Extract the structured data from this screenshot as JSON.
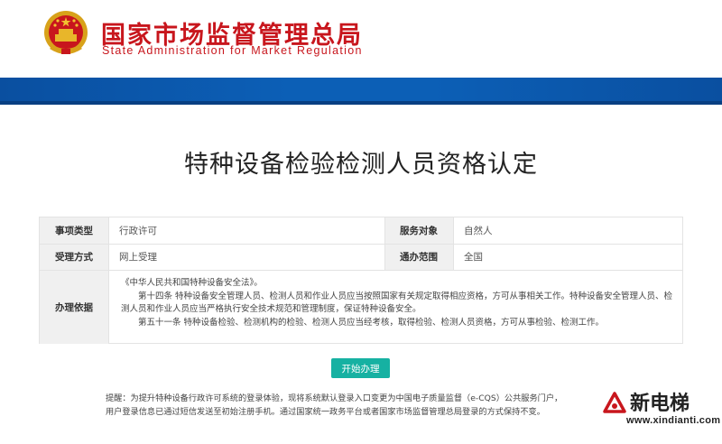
{
  "header": {
    "org_name_cn": "国家市场监督管理总局",
    "org_name_en": "State Administration for Market Regulation",
    "emblem_icon": "national-emblem-icon",
    "brand_color": "#c8161d",
    "bar_color": "#0c5fb6"
  },
  "page": {
    "title": "特种设备检验检测人员资格认定"
  },
  "info": {
    "type_label": "事项类型",
    "type_value": "行政许可",
    "target_label": "服务对象",
    "target_value": "自然人",
    "method_label": "受理方式",
    "method_value": "网上受理",
    "scope_label": "通办范围",
    "scope_value": "全国",
    "basis_label": "办理依据",
    "basis_lines": [
      "《中华人民共和国特种设备安全法》。",
      "第十四条 特种设备安全管理人员、检测人员和作业人员应当按照国家有关规定取得相应资格，方可从事相关工作。特种设备安全管理人员、检测人员和作业人员应当严格执行安全技术规范和管理制度，保证特种设备安全。",
      "第五十一条 特种设备检验、检测机构的检验、检测人员应当经考核，取得检验、检测人员资格，方可从事检验、检测工作。"
    ]
  },
  "actions": {
    "start_label": "开始办理",
    "start_color": "#16b1a2"
  },
  "notice": {
    "line1": "提醒：为提升特种设备行政许可系统的登录体验，现将系统默认登录入口变更为中国电子质量监督（e-CQS）公共服务门户，",
    "line2": "用户登录信息已通过短信发送至初始注册手机。通过国家统一政务平台或者国家市场监督管理总局登录的方式保持不变。"
  },
  "watermark": {
    "text": "新电梯",
    "url": "www.xindianti.com",
    "icon": "elevator-logo-icon"
  }
}
